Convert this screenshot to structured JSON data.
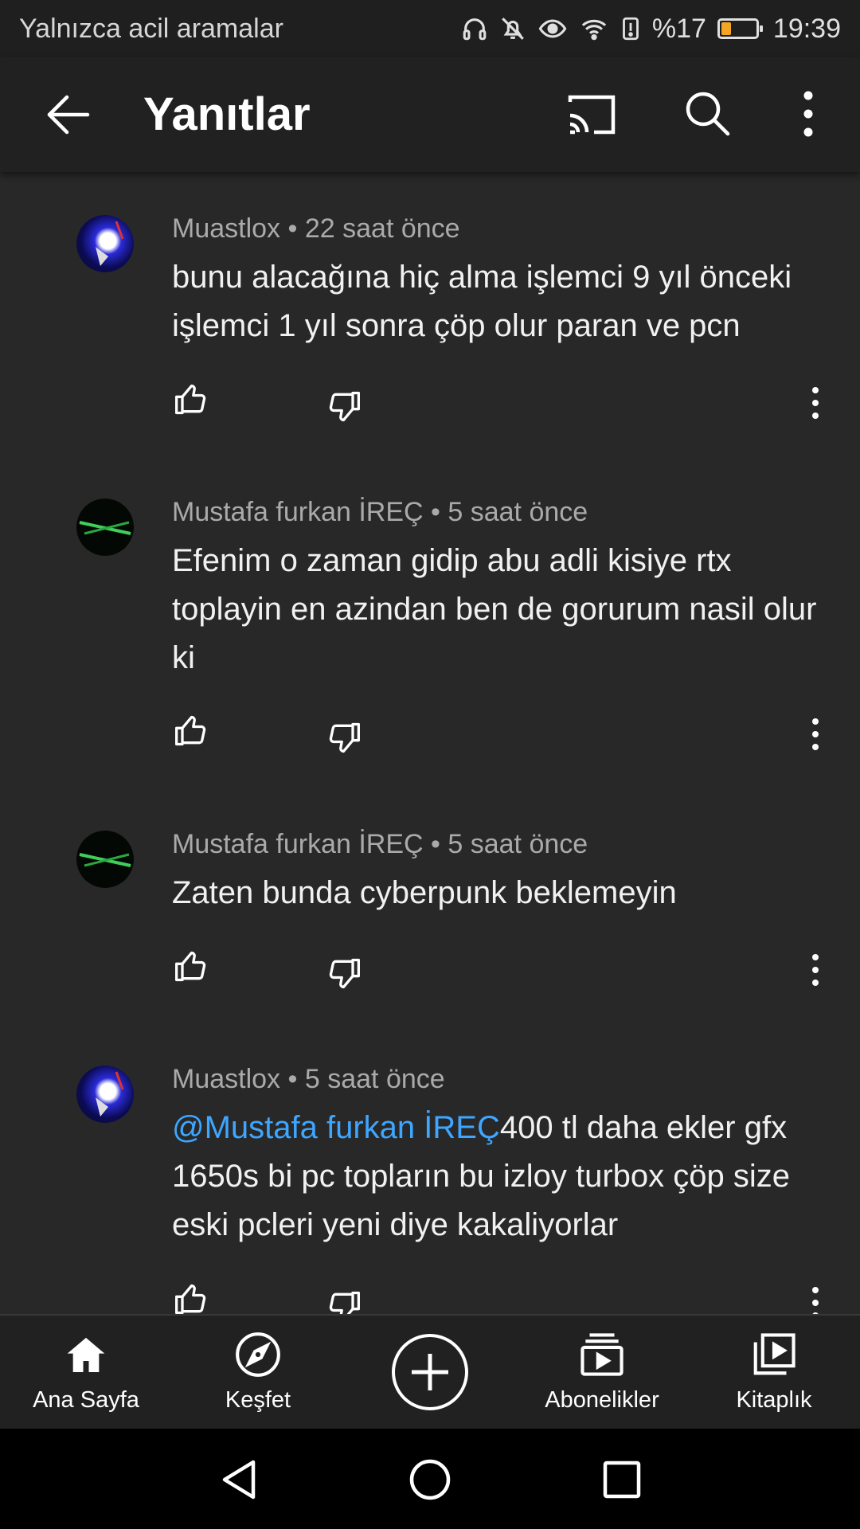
{
  "status_bar": {
    "carrier_text": "Yalnızca acil aramalar",
    "battery_text": "%17",
    "time": "19:39",
    "icons": [
      "headphones-icon",
      "mute-icon",
      "eye-icon",
      "wifi-icon",
      "alert-icon",
      "battery-icon"
    ]
  },
  "app_bar": {
    "title": "Yanıtlar",
    "icons": [
      "back-arrow-icon",
      "cast-icon",
      "search-icon",
      "more-vert-icon"
    ]
  },
  "comments": [
    {
      "author": "Muastlox",
      "time": "22 saat önce",
      "mention": "",
      "text": "bunu alacağına hiç alma işlemci 9 yıl önceki işlemci 1 yıl sonra çöp olur paran ve pcn"
    },
    {
      "author": "Mustafa furkan İREÇ",
      "time": "5 saat önce",
      "mention": "",
      "text": "Efenim o zaman gidip abu adli kisiye rtx toplayin en azindan ben de gorurum nasil olur ki"
    },
    {
      "author": "Mustafa furkan İREÇ",
      "time": "5 saat önce",
      "mention": "",
      "text": "Zaten bunda cyberpunk beklemeyin"
    },
    {
      "author": "Muastlox",
      "time": "5 saat önce",
      "mention": "@Mustafa furkan İREÇ",
      "text": "400 tl daha ekler gfx 1650s bi pc topların bu izloy turbox çöp size eski pcleri yeni diye kakaliyorlar"
    }
  ],
  "meta_separator": "•",
  "bottom_nav": [
    {
      "label": "Ana Sayfa",
      "icon": "home-icon"
    },
    {
      "label": "Keşfet",
      "icon": "explore-compass-icon"
    },
    {
      "label": "",
      "icon": "create-plus-icon"
    },
    {
      "label": "Abonelikler",
      "icon": "subscriptions-icon"
    },
    {
      "label": "Kitaplık",
      "icon": "library-icon"
    }
  ],
  "system_nav": [
    "back-triangle-icon",
    "home-circle-icon",
    "recents-square-icon"
  ],
  "colors": {
    "background": "#282828",
    "app_bar": "#212121",
    "mention": "#3ea6ff",
    "meta_text": "#aaaaaa",
    "battery_fill": "#f5a524"
  }
}
